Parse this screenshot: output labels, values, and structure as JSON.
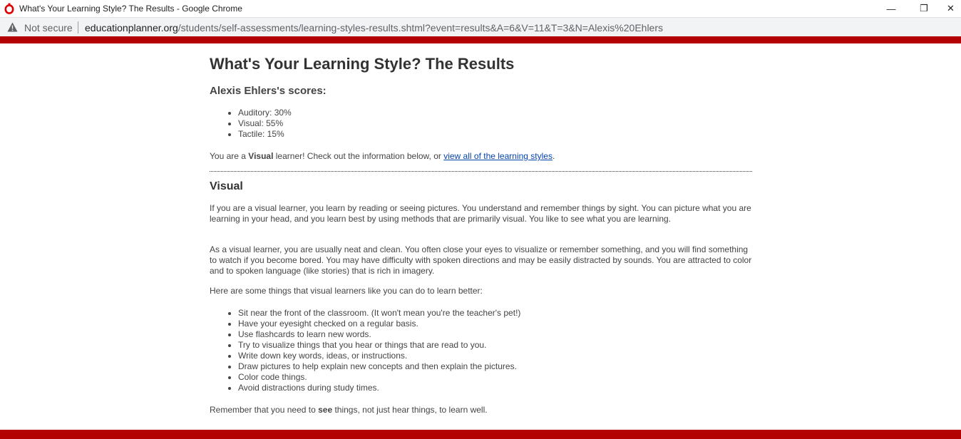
{
  "window": {
    "title": "What's Your Learning Style? The Results - Google Chrome",
    "minimize_glyph": "—",
    "restore_glyph": "❐",
    "close_glyph": "✕"
  },
  "addressbar": {
    "security_label": "Not secure",
    "url_host": "educationplanner.org",
    "url_path": "/students/self-assessments/learning-styles-results.shtml?event=results&A=6&V=11&T=3&N=Alexis%20Ehlers"
  },
  "colors": {
    "brand_red": "#b30000",
    "link_blue": "#0645ad"
  },
  "page": {
    "title": "What's Your Learning Style? The Results",
    "scores_heading": "Alexis Ehlers's scores:",
    "scores": [
      "Auditory: 30%",
      "Visual: 55%",
      "Tactile: 15%"
    ],
    "result_prefix": "You are a ",
    "result_style": "Visual",
    "result_middle": " learner! Check out the information below, or ",
    "result_link": "view all of the learning styles",
    "result_suffix": ".",
    "section_heading": "Visual",
    "paragraph1": "If you are a visual learner, you learn by reading or seeing pictures. You understand and remember things by sight. You can picture what you are learning in your head, and you learn best by using methods that are primarily visual. You like to see what you are learning.",
    "paragraph2": "As a visual learner, you are usually neat and clean. You often close your eyes to visualize or remember something, and you will find something to watch if you become bored. You may have difficulty with spoken directions and may be easily distracted by sounds. You are attracted to color and to spoken language (like stories) that is rich in imagery.",
    "paragraph3": "Here are some things that visual learners like you can do to learn better:",
    "tips": [
      "Sit near the front of the classroom. (It won't mean you're the teacher's pet!)",
      "Have your eyesight checked on a regular basis.",
      "Use flashcards to learn new words.",
      "Try to visualize things that you hear or things that are read to you.",
      "Write down key words, ideas, or instructions.",
      "Draw pictures to help explain new concepts and then explain the pictures.",
      "Color code things.",
      "Avoid distractions during study times."
    ],
    "closing_prefix": "Remember that you need to ",
    "closing_bold": "see",
    "closing_suffix": " things, not just hear things, to learn well."
  }
}
